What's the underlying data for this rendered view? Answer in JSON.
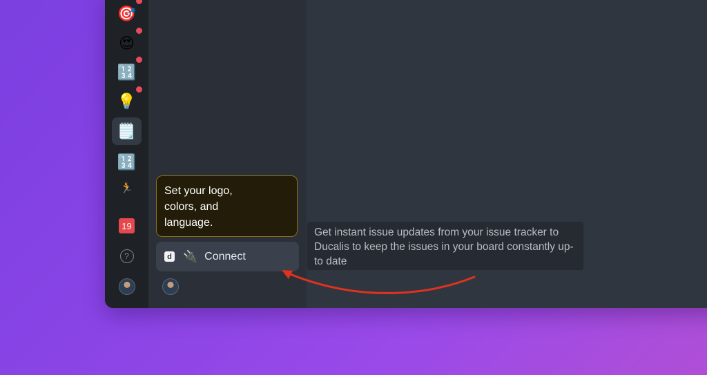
{
  "rail": {
    "items": [
      {
        "icon": "dart-target-icon",
        "glyph": "🎯",
        "notification": true
      },
      {
        "icon": "heart-eyes-emoji-icon",
        "glyph": "😍",
        "notification": true
      },
      {
        "icon": "numbers-1234-icon",
        "glyph": "🔢",
        "notification": true
      },
      {
        "icon": "lightbulb-icon",
        "glyph": "💡",
        "notification": true
      },
      {
        "icon": "notepad-icon",
        "glyph": "🗒️",
        "active": true
      },
      {
        "icon": "numbers-1234-icon",
        "glyph": "🔢"
      },
      {
        "icon": "running-person-icon",
        "glyph": "🏃"
      }
    ],
    "calendar_day": "19",
    "help_glyph": "?"
  },
  "tooltip_customize": {
    "text": "Set your logo, colors, and language."
  },
  "connect": {
    "logo_letter": "d",
    "plug_glyph": "🔌",
    "label": "Connect"
  },
  "tooltip_integration": {
    "text": "Get instant issue updates from your issue tracker to Ducalis to keep the issues in your board constantly up-to date"
  },
  "colors": {
    "background_gradient_start": "#7b3fe0",
    "background_gradient_end": "#b04fd6",
    "rail": "#1e2227",
    "panel": "#2b3038",
    "main": "#303640",
    "notification_dot": "#e94b5c",
    "arrow": "#e0321f",
    "tooltip_border": "#8a6f1c"
  }
}
